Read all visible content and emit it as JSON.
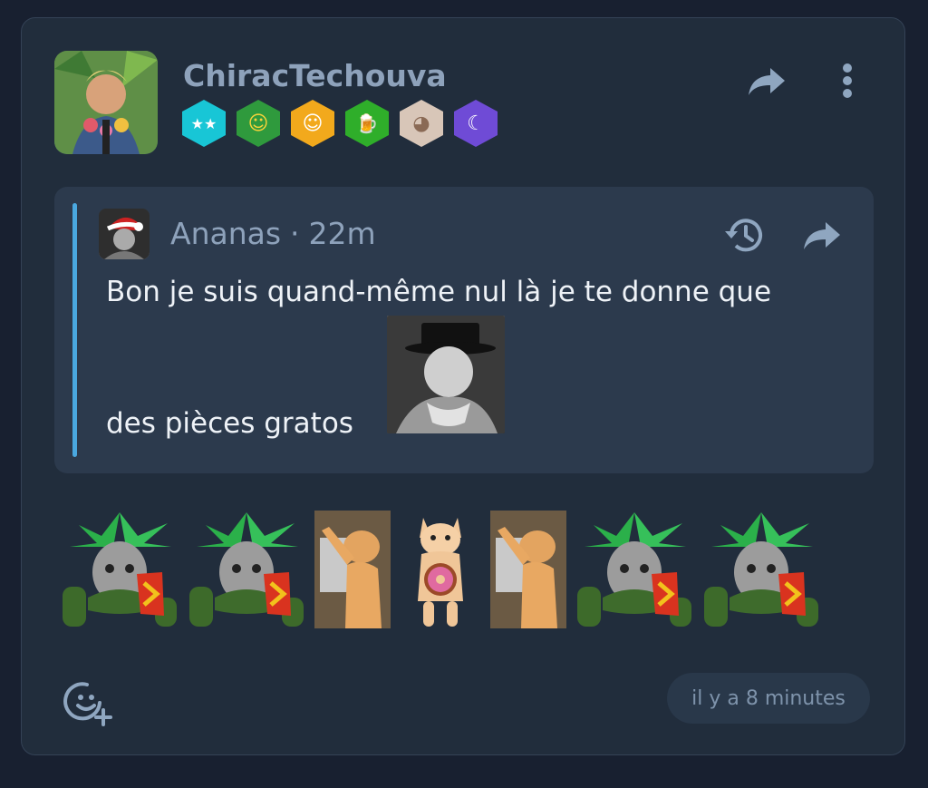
{
  "post": {
    "username": "ChiracTechouva",
    "avatar_icon": "user-avatar-icon",
    "badges": [
      {
        "name": "stars-badge-icon",
        "glyph": "★★",
        "color": "#18c6d6"
      },
      {
        "name": "santa-badge-icon",
        "glyph": "☺",
        "color": "#2f9a3d"
      },
      {
        "name": "hands-badge-icon",
        "glyph": "☺",
        "color": "#f2a91c"
      },
      {
        "name": "beer-badge-icon",
        "glyph": "🍺",
        "color": "#2fae2a"
      },
      {
        "name": "cat-badge-icon",
        "glyph": "◕",
        "color": "#d8c6b8"
      },
      {
        "name": "moon-badge-icon",
        "glyph": "☾",
        "color": "#6f4bd6"
      }
    ],
    "timestamp": "il y a 8 minutes"
  },
  "quote": {
    "author": "Ananas",
    "separator": "·",
    "time": "22m",
    "line1": "Bon je suis quand-même nul là je te donne que",
    "line2": "des pièces gratos"
  },
  "stickers": [
    "pineapple-cat",
    "pineapple-cat",
    "dancing-cat",
    "donut-cat",
    "dancing-cat",
    "pineapple-cat",
    "pineapple-cat"
  ],
  "colors": {
    "accent": "#4aa8e0",
    "background": "#182030",
    "card": "#212d3c"
  }
}
